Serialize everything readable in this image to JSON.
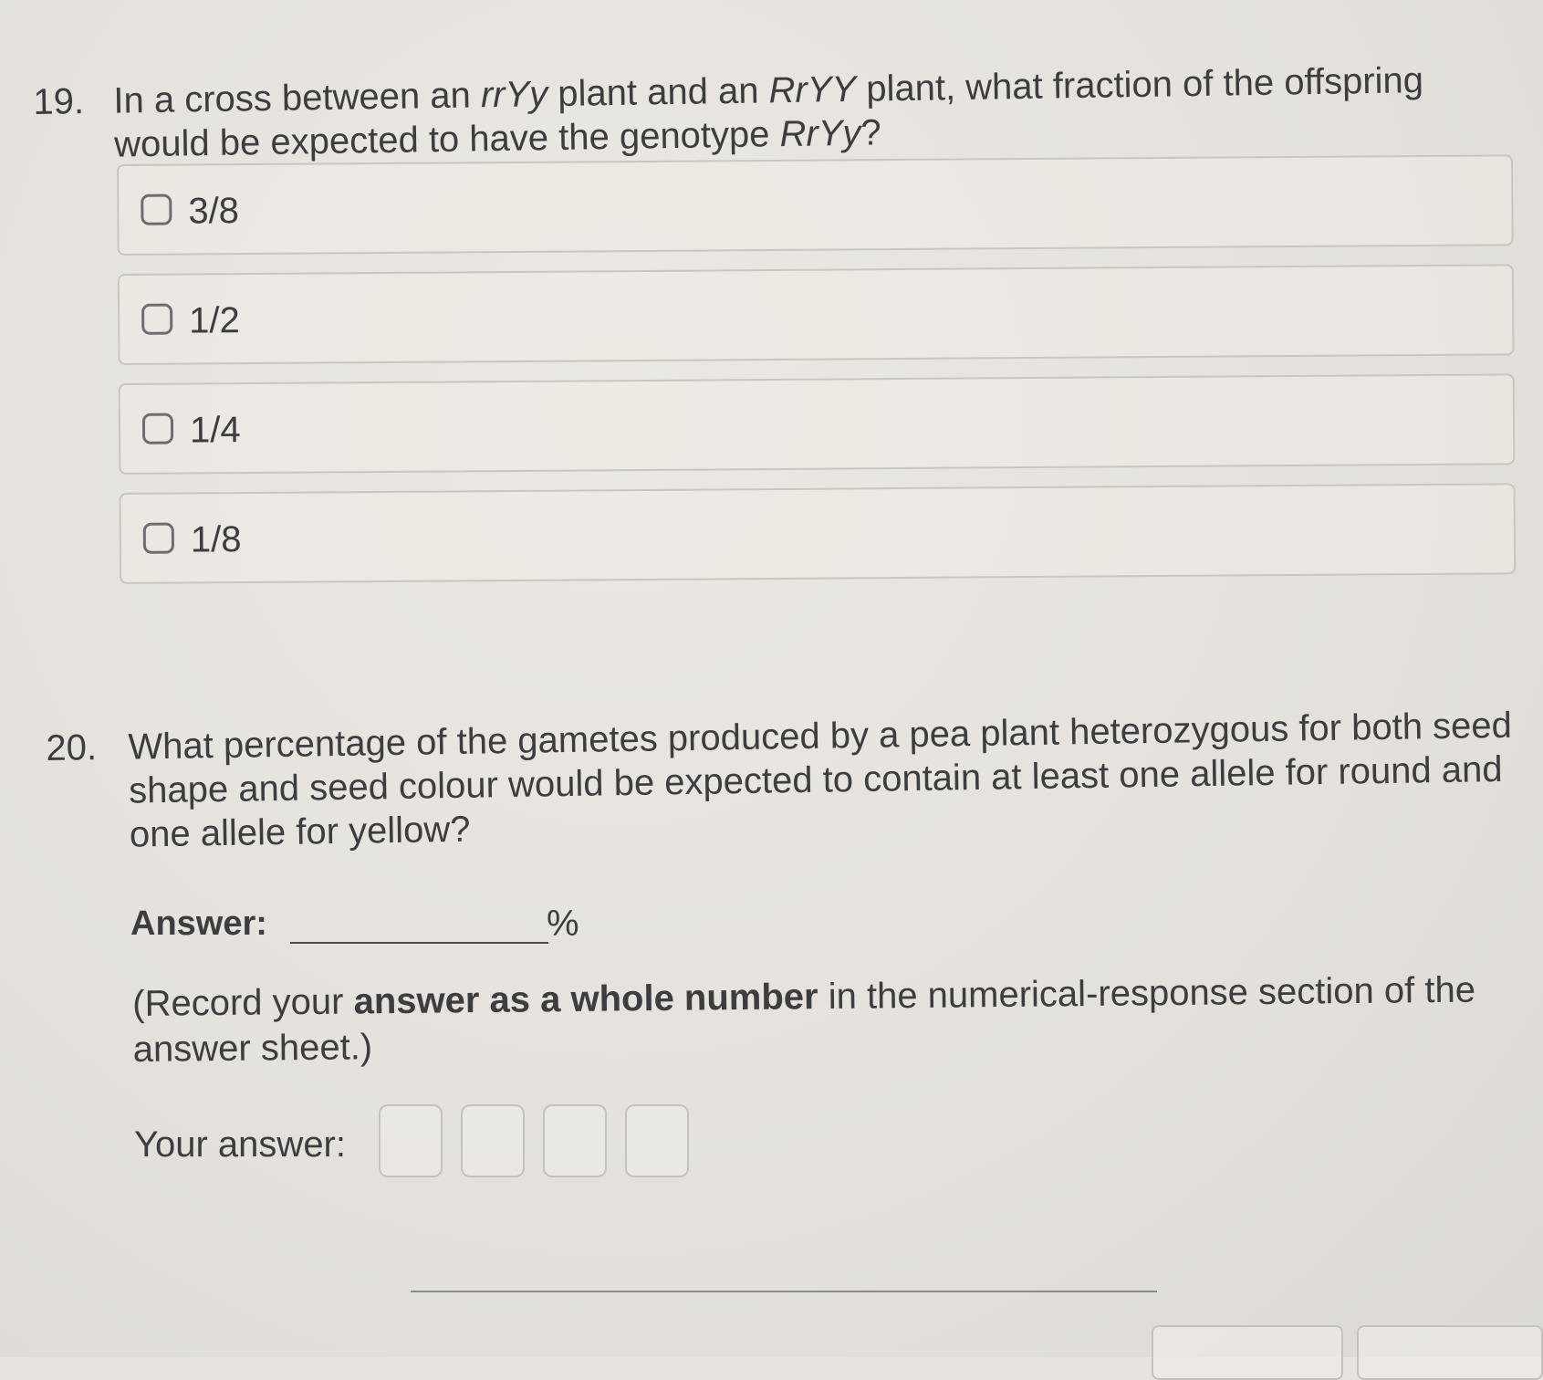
{
  "question19": {
    "number": "19.",
    "text_parts": {
      "p1": "In a cross between an ",
      "g1": "rrYy",
      "p2": " plant and an ",
      "g2": "RrYY",
      "p3": " plant, what fraction of the offspring would be expected to have the genotype ",
      "g3": "RrYy",
      "p4": "?"
    },
    "options": [
      {
        "label": "3/8"
      },
      {
        "label": "1/2"
      },
      {
        "label": "1/4"
      },
      {
        "label": "1/8"
      }
    ]
  },
  "question20": {
    "number": "20.",
    "text": "What percentage of the gametes produced by a pea plant heterozygous for both seed shape and seed colour would be expected to contain at least one allele for round and one allele for yellow?",
    "answer_label": "Answer:",
    "answer_unit": "%",
    "note": {
      "pre": "(Record your ",
      "bold": "answer as a whole number",
      "post": " in the numerical-response section of the answer sheet.)"
    },
    "your_answer_label": "Your answer:",
    "digit_boxes": 4
  }
}
